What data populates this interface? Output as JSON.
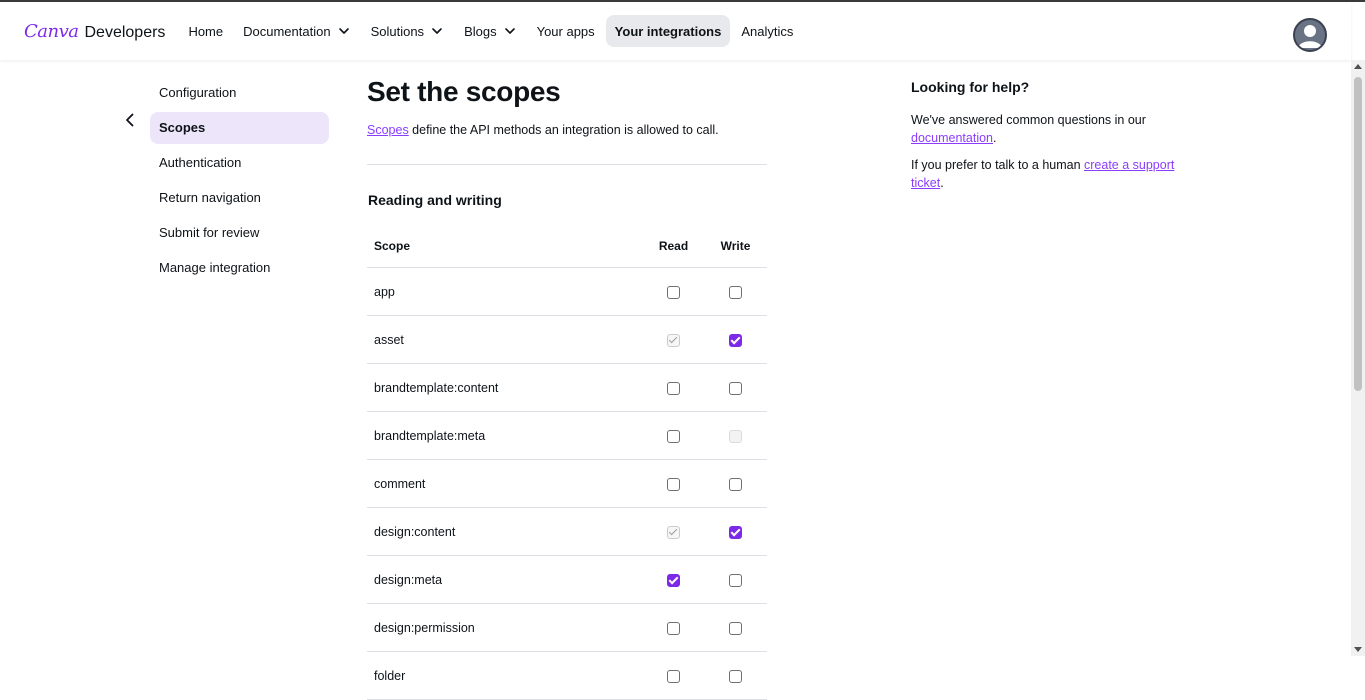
{
  "header": {
    "brand": "Canva",
    "product": "Developers",
    "nav": [
      {
        "label": "Home",
        "dropdown": false,
        "active": false
      },
      {
        "label": "Documentation",
        "dropdown": true,
        "active": false
      },
      {
        "label": "Solutions",
        "dropdown": true,
        "active": false
      },
      {
        "label": "Blogs",
        "dropdown": true,
        "active": false
      },
      {
        "label": "Your apps",
        "dropdown": false,
        "active": false
      },
      {
        "label": "Your integrations",
        "dropdown": false,
        "active": true
      },
      {
        "label": "Analytics",
        "dropdown": false,
        "active": false
      }
    ],
    "avatar_icon": "user-avatar-icon"
  },
  "sidebar": {
    "back_icon": "chevron-left-icon",
    "items": [
      {
        "label": "Configuration",
        "active": false
      },
      {
        "label": "Scopes",
        "active": true
      },
      {
        "label": "Authentication",
        "active": false
      },
      {
        "label": "Return navigation",
        "active": false
      },
      {
        "label": "Submit for review",
        "active": false
      },
      {
        "label": "Manage integration",
        "active": false
      }
    ]
  },
  "main": {
    "title": "Set the scopes",
    "intro_link": "Scopes",
    "intro_text": " define the API methods an integration is allowed to call.",
    "section_title": "Reading and writing",
    "columns": {
      "scope": "Scope",
      "read": "Read",
      "write": "Write"
    },
    "rows": [
      {
        "scope": "app",
        "read": "unchecked",
        "write": "unchecked"
      },
      {
        "scope": "asset",
        "read": "implied",
        "write": "checked"
      },
      {
        "scope": "brandtemplate:content",
        "read": "unchecked",
        "write": "unchecked"
      },
      {
        "scope": "brandtemplate:meta",
        "read": "unchecked",
        "write": "disabled"
      },
      {
        "scope": "comment",
        "read": "unchecked",
        "write": "unchecked"
      },
      {
        "scope": "design:content",
        "read": "implied",
        "write": "checked"
      },
      {
        "scope": "design:meta",
        "read": "checked",
        "write": "unchecked"
      },
      {
        "scope": "design:permission",
        "read": "unchecked",
        "write": "unchecked"
      },
      {
        "scope": "folder",
        "read": "unchecked",
        "write": "unchecked"
      }
    ]
  },
  "help": {
    "title": "Looking for help?",
    "p1_text": "We've answered common questions in our ",
    "p1_link": "documentation",
    "p1_end": ".",
    "p2_text": "If you prefer to talk to a human ",
    "p2_link": "create a support ticket",
    "p2_end": "."
  },
  "colors": {
    "accent": "#7d2ae8",
    "link": "#8b3dff",
    "active_side_bg": "#ede6fb",
    "active_nav_bg": "#e8e9ed"
  }
}
